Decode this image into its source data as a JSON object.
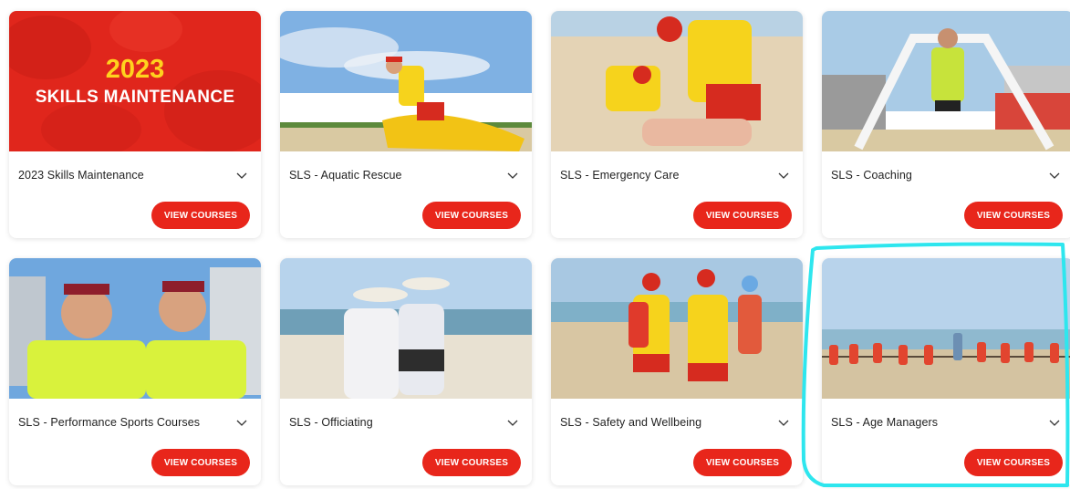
{
  "courses": [
    {
      "title": "2023 Skills Maintenance",
      "button": "VIEW COURSES",
      "image": "skills-maintenance-banner",
      "overlay_line1": "2023",
      "overlay_line2": "SKILLS MAINTENANCE"
    },
    {
      "title": "SLS - Aquatic Rescue",
      "button": "VIEW COURSES",
      "image": "lifeguard-carrying-rescue-board-photo"
    },
    {
      "title": "SLS - Emergency Care",
      "button": "VIEW COURSES",
      "image": "lifeguards-performing-cpr-photo"
    },
    {
      "title": "SLS - Coaching",
      "button": "VIEW COURSES",
      "image": "athlete-breaking-finish-tape-photo"
    },
    {
      "title": "SLS - Performance Sports Courses",
      "button": "VIEW COURSES",
      "image": "two-athletes-celebrating-photo"
    },
    {
      "title": "SLS - Officiating",
      "button": "VIEW COURSES",
      "image": "beach-officials-with-clipboard-photo"
    },
    {
      "title": "SLS - Safety and Wellbeing",
      "button": "VIEW COURSES",
      "image": "nippers-with-lifeguards-photo"
    },
    {
      "title": "SLS - Age Managers",
      "button": "VIEW COURSES",
      "image": "tug-of-war-on-beach-photo"
    }
  ],
  "colors": {
    "accent": "#e8261b",
    "highlight": "#2ee6ee",
    "banner_red": "#e0261c",
    "overlay_yellow": "#ffd21e"
  },
  "icons": {
    "expand": "chevron-down-icon"
  },
  "highlighted_card": "SLS - Age Managers"
}
